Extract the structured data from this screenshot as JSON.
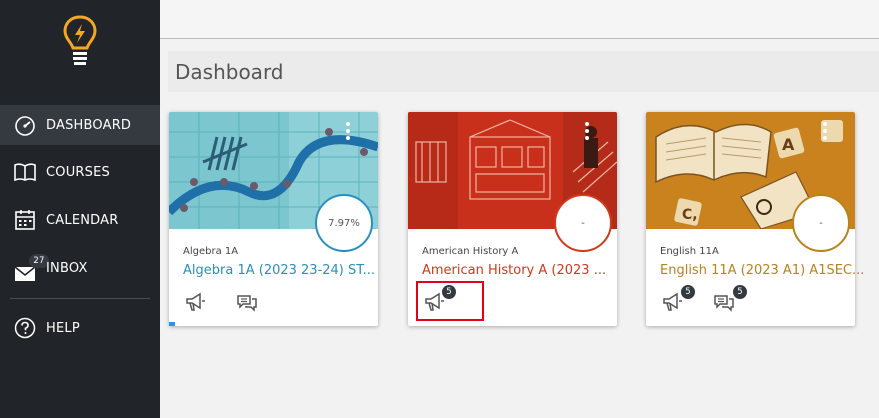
{
  "sidebar": {
    "items": [
      {
        "label": "DASHBOARD"
      },
      {
        "label": "COURSES"
      },
      {
        "label": "CALENDAR"
      },
      {
        "label": "INBOX",
        "badge": "27"
      },
      {
        "label": "HELP"
      }
    ]
  },
  "header": {
    "title": "Dashboard"
  },
  "cards": [
    {
      "subtitle": "Algebra 1A",
      "title": "Algebra 1A (2023 23-24) ST...",
      "grade": "7.97%",
      "accent": "#2a8fbd",
      "announcements": "",
      "discussions": ""
    },
    {
      "subtitle": "American History A",
      "title": "American History A (2023 ...",
      "grade": "-",
      "accent": "#d0391b",
      "announcements": "5",
      "discussions": ""
    },
    {
      "subtitle": "English 11A",
      "title": "English 11A (2023 A1) A1SEC...",
      "grade": "-",
      "accent": "#b8821c",
      "announcements": "5",
      "discussions": "5"
    }
  ]
}
